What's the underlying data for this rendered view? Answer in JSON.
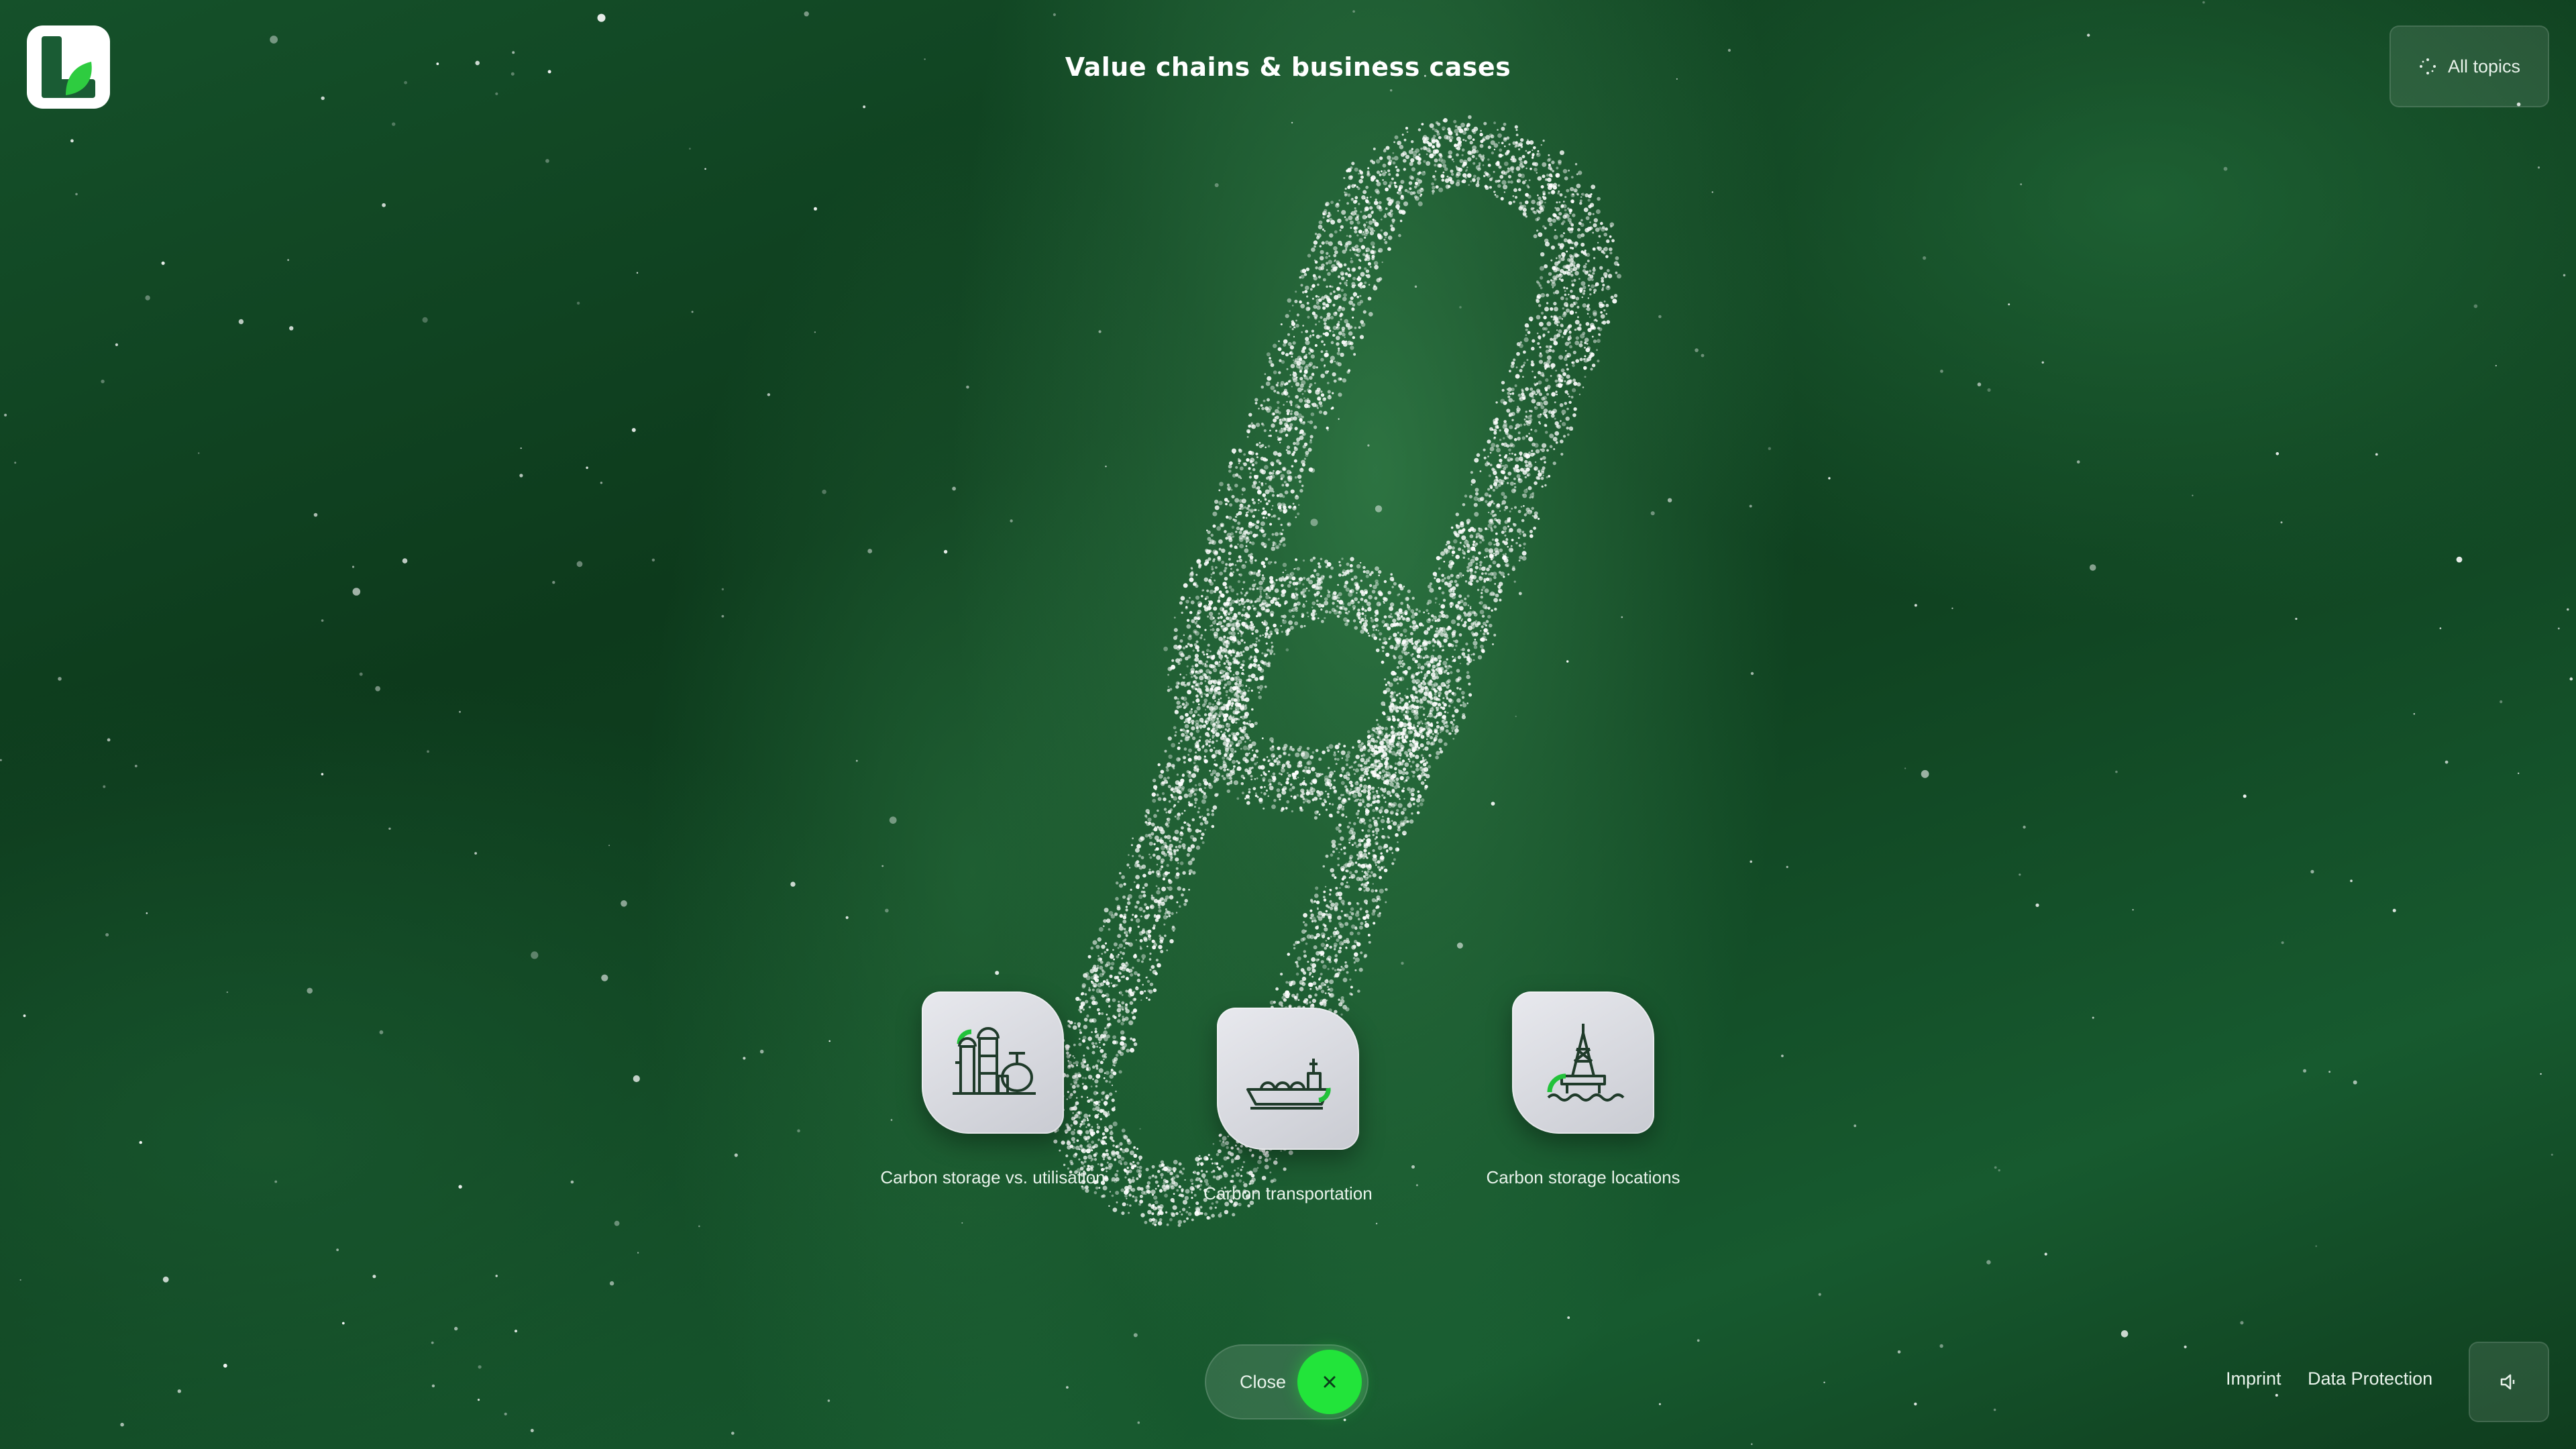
{
  "header": {
    "title": "Value chains & business cases",
    "all_topics_label": "All topics"
  },
  "topics": [
    {
      "label": "Carbon storage vs. utilisation",
      "icon": "industrial-plant-icon"
    },
    {
      "label": "Carbon transportation",
      "icon": "tanker-ship-icon"
    },
    {
      "label": "Carbon storage locations",
      "icon": "offshore-rig-icon"
    }
  ],
  "close": {
    "label": "Close"
  },
  "footer": {
    "imprint": "Imprint",
    "data_protection": "Data Protection"
  },
  "icons": {
    "logo": "brand-logo-icon",
    "all_topics": "grid-dots-icon",
    "close": "close-icon",
    "sound": "speaker-muted-icon"
  },
  "colors": {
    "accent_green": "#22e43a",
    "icon_stroke": "#1f3b2a",
    "background": "#0d3a1c"
  }
}
